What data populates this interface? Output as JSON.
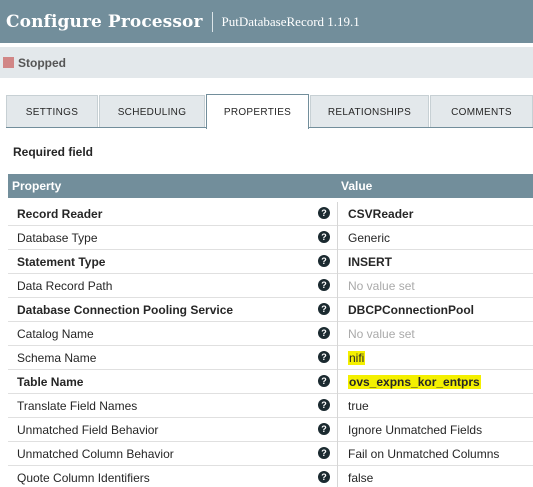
{
  "header": {
    "title": "Configure Processor",
    "subtitle": "PutDatabaseRecord 1.19.1"
  },
  "status": {
    "label": "Stopped",
    "color": "#d18686"
  },
  "tabs": [
    {
      "label": "SETTINGS",
      "active": false
    },
    {
      "label": "SCHEDULING",
      "active": false
    },
    {
      "label": "PROPERTIES",
      "active": true
    },
    {
      "label": "RELATIONSHIPS",
      "active": false
    },
    {
      "label": "COMMENTS",
      "active": false
    }
  ],
  "required_label": "Required field",
  "table": {
    "headers": {
      "property": "Property",
      "value": "Value"
    },
    "help_glyph": "?",
    "rows": [
      {
        "name": "Record Reader",
        "required": true,
        "value": "CSVReader",
        "value_bold": true,
        "empty": false,
        "highlighted": false
      },
      {
        "name": "Database Type",
        "required": false,
        "value": "Generic",
        "value_bold": false,
        "empty": false,
        "highlighted": false
      },
      {
        "name": "Statement Type",
        "required": true,
        "value": "INSERT",
        "value_bold": true,
        "empty": false,
        "highlighted": false
      },
      {
        "name": "Data Record Path",
        "required": false,
        "value": "No value set",
        "value_bold": false,
        "empty": true,
        "highlighted": false
      },
      {
        "name": "Database Connection Pooling Service",
        "required": true,
        "value": "DBCPConnectionPool",
        "value_bold": true,
        "empty": false,
        "highlighted": false
      },
      {
        "name": "Catalog Name",
        "required": false,
        "value": "No value set",
        "value_bold": false,
        "empty": true,
        "highlighted": false
      },
      {
        "name": "Schema Name",
        "required": false,
        "value": "nifi",
        "value_bold": false,
        "empty": false,
        "highlighted": true
      },
      {
        "name": "Table Name",
        "required": true,
        "value": "ovs_expns_kor_entprs",
        "value_bold": true,
        "empty": false,
        "highlighted": true
      },
      {
        "name": "Translate Field Names",
        "required": false,
        "value": "true",
        "value_bold": false,
        "empty": false,
        "highlighted": false
      },
      {
        "name": "Unmatched Field Behavior",
        "required": false,
        "value": "Ignore Unmatched Fields",
        "value_bold": false,
        "empty": false,
        "highlighted": false
      },
      {
        "name": "Unmatched Column Behavior",
        "required": false,
        "value": "Fail on Unmatched Columns",
        "value_bold": false,
        "empty": false,
        "highlighted": false
      },
      {
        "name": "Quote Column Identifiers",
        "required": false,
        "value": "false",
        "value_bold": false,
        "empty": false,
        "highlighted": false
      }
    ]
  },
  "colors": {
    "header_bg": "#728e9b",
    "status_bg": "#e3e8eb",
    "highlight": "#f4f000"
  }
}
